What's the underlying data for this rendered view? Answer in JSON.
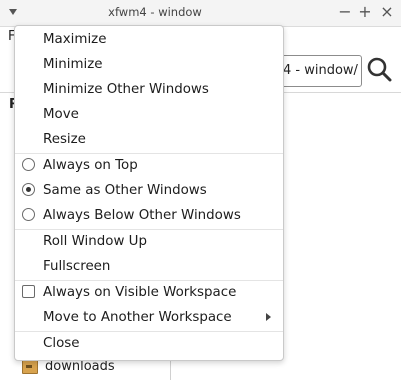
{
  "window": {
    "title": "xfwm4 - window",
    "menubar_stub": "F",
    "address_text": "4 - window/",
    "left_pane_letter": "R",
    "sidebar_item": {
      "label": "downloads",
      "icon": "folder-downloads-icon"
    },
    "controls": {
      "minimize": "−",
      "maximize": "+",
      "close": "×"
    }
  },
  "context_menu": {
    "items": [
      {
        "label": "Maximize"
      },
      {
        "label": "Minimize"
      },
      {
        "label": "Minimize Other Windows"
      },
      {
        "label": "Move"
      },
      {
        "label": "Resize"
      },
      {
        "label": "Always on Top",
        "control": "radio",
        "checked": false
      },
      {
        "label": "Same as Other Windows",
        "control": "radio",
        "checked": true
      },
      {
        "label": "Always Below Other Windows",
        "control": "radio",
        "checked": false
      },
      {
        "label": "Roll Window Up"
      },
      {
        "label": "Fullscreen"
      },
      {
        "label": "Always on Visible Workspace",
        "control": "checkbox",
        "checked": false
      },
      {
        "label": "Move to Another Workspace",
        "submenu": true
      },
      {
        "label": "Close"
      }
    ]
  }
}
